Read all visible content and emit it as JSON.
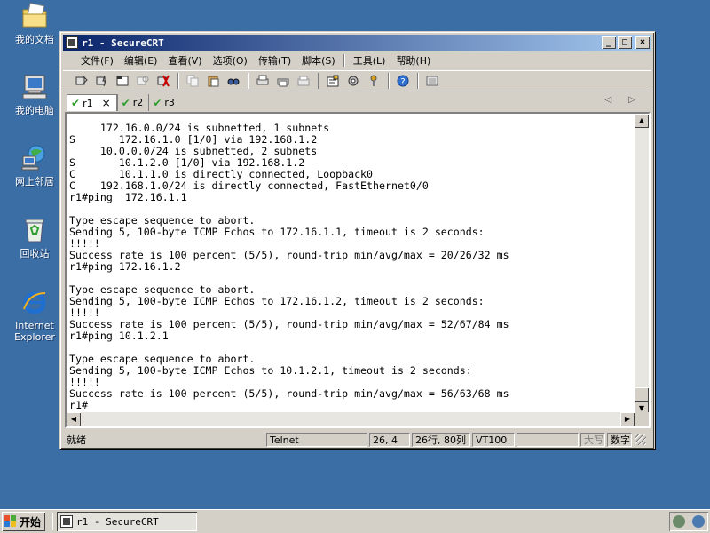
{
  "desktop": {
    "icons": [
      {
        "label": "我的文档",
        "icon": "my-documents-icon"
      },
      {
        "label": "我的电脑",
        "icon": "my-computer-icon"
      },
      {
        "label": "网上邻居",
        "icon": "network-icon"
      },
      {
        "label": "回收站",
        "icon": "recycle-bin-icon"
      },
      {
        "label": "Internet Explorer",
        "icon": "ie-icon"
      }
    ]
  },
  "window": {
    "title": "r1 - SecureCRT",
    "controls": {
      "minimize": "_",
      "maximize": "□",
      "close": "×"
    }
  },
  "menu": {
    "items": [
      "文件(F)",
      "编辑(E)",
      "查看(V)",
      "选项(O)",
      "传输(T)",
      "脚本(S)",
      "工具(L)",
      "帮助(H)"
    ]
  },
  "tabs": [
    {
      "label": "r1",
      "active": true,
      "close": "×"
    },
    {
      "label": "r2",
      "active": false
    },
    {
      "label": "r3",
      "active": false
    }
  ],
  "tab_nav": "◁ ▷",
  "terminal": {
    "text": "     172.16.0.0/24 is subnetted, 1 subnets\nS       172.16.1.0 [1/0] via 192.168.1.2\n     10.0.0.0/24 is subnetted, 2 subnets\nS       10.1.2.0 [1/0] via 192.168.1.2\nC       10.1.1.0 is directly connected, Loopback0\nC    192.168.1.0/24 is directly connected, FastEthernet0/0\nr1#ping  172.16.1.1\n\nType escape sequence to abort.\nSending 5, 100-byte ICMP Echos to 172.16.1.1, timeout is 2 seconds:\n!!!!!\nSuccess rate is 100 percent (5/5), round-trip min/avg/max = 20/26/32 ms\nr1#ping 172.16.1.2\n\nType escape sequence to abort.\nSending 5, 100-byte ICMP Echos to 172.16.1.2, timeout is 2 seconds:\n!!!!!\nSuccess rate is 100 percent (5/5), round-trip min/avg/max = 52/67/84 ms\nr1#ping 10.1.2.1\n\nType escape sequence to abort.\nSending 5, 100-byte ICMP Echos to 10.1.2.1, timeout is 2 seconds:\n!!!!!\nSuccess rate is 100 percent (5/5), round-trip min/avg/max = 56/63/68 ms\nr1#"
  },
  "status": {
    "ready": "就绪",
    "protocol": "Telnet",
    "cursor": "26,  4",
    "size": "26行, 80列",
    "emulation": "VT100",
    "blank": "",
    "caps": "大写",
    "num": "数字"
  },
  "taskbar": {
    "start_label": "开始",
    "task_label": "r1 - SecureCRT"
  },
  "colors": {
    "desktop": "#3a6ea5",
    "title_start": "#0a246a",
    "title_end": "#a6caf0",
    "check": "#2e9e2e"
  }
}
